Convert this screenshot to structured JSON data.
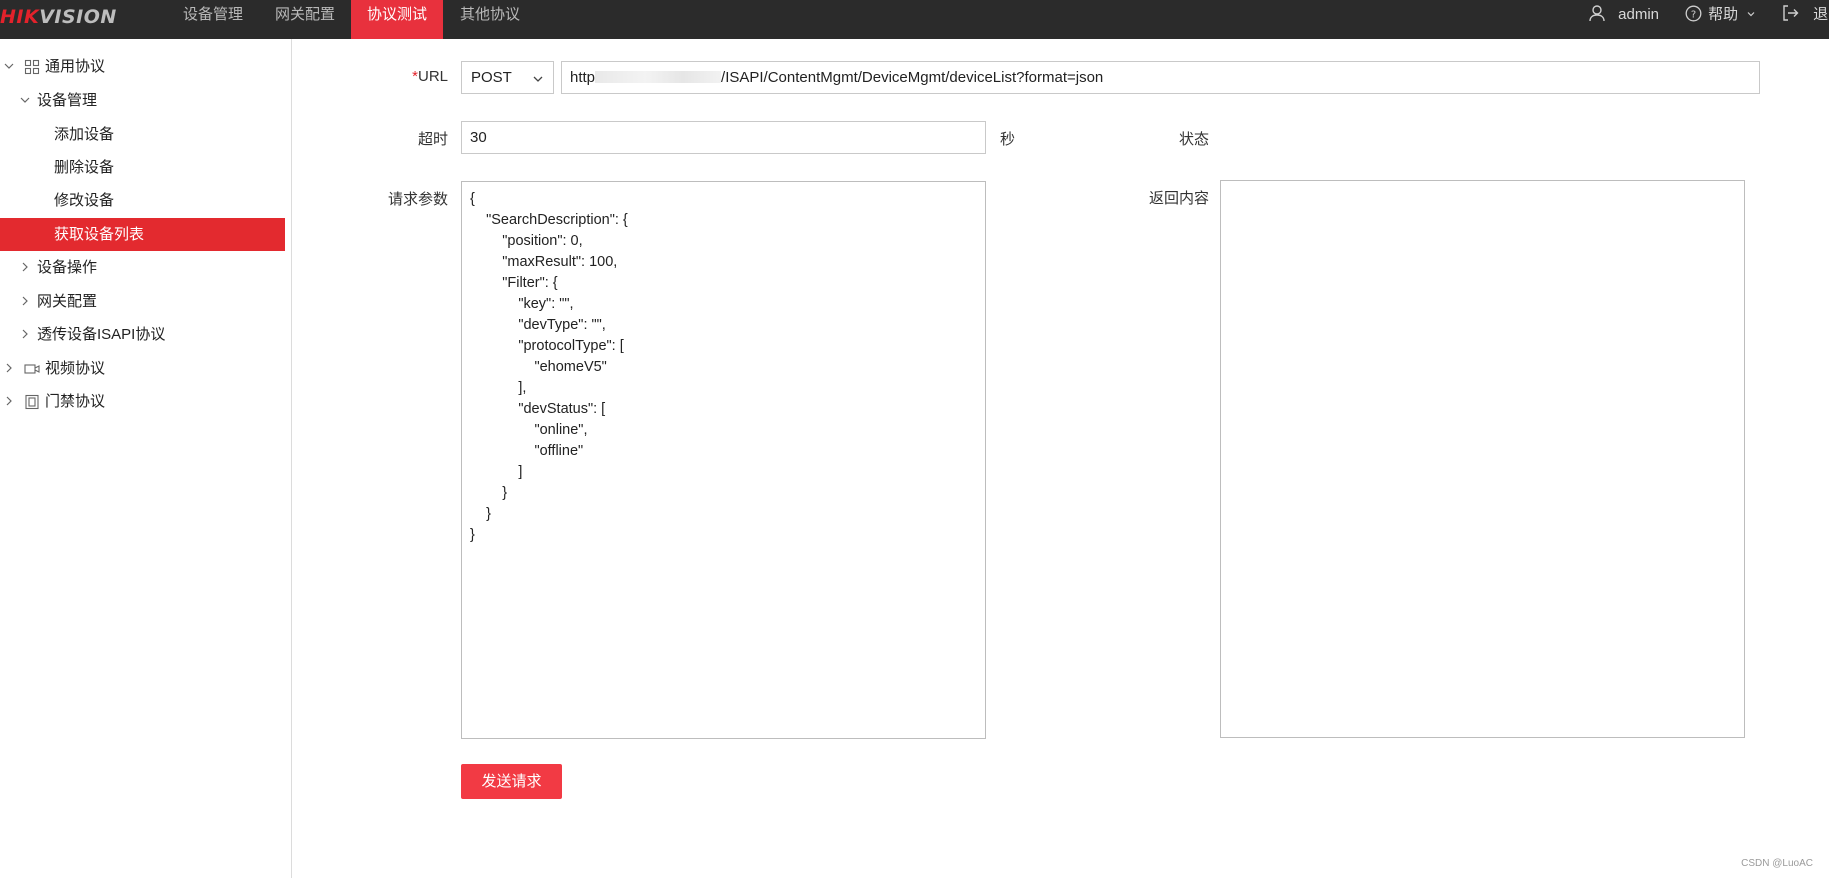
{
  "header": {
    "logo_text_red": "HIK",
    "logo_text_rest": "VISION",
    "tabs": [
      {
        "label": "设备管理"
      },
      {
        "label": "网关配置"
      },
      {
        "label": "协议测试"
      },
      {
        "label": "其他协议"
      }
    ],
    "active_tab": "协议测试",
    "user": "admin",
    "help": "帮助",
    "logout": "退"
  },
  "sidebar": {
    "items": [
      {
        "label": "通用协议",
        "icon": "grid-icon",
        "expanded": true
      },
      {
        "label": "设备管理",
        "expanded": true
      },
      {
        "label": "添加设备"
      },
      {
        "label": "删除设备"
      },
      {
        "label": "修改设备"
      },
      {
        "label": "获取设备列表",
        "selected": true
      },
      {
        "label": "设备操作",
        "expanded": false
      },
      {
        "label": "网关配置",
        "expanded": false
      },
      {
        "label": "透传设备ISAPI协议",
        "expanded": false
      },
      {
        "label": "视频协议",
        "icon": "camera-icon",
        "expanded": false
      },
      {
        "label": "门禁协议",
        "icon": "door-icon",
        "expanded": false
      }
    ]
  },
  "form": {
    "url_required_mark": "*",
    "url_label": "URL",
    "method": "POST",
    "url_prefix": "http",
    "url_value": "/ISAPI/ContentMgmt/DeviceMgmt/deviceList?format=json",
    "timeout_label": "超时",
    "timeout_value": "30",
    "timeout_unit": "秒",
    "status_label": "状态",
    "params_label": "请求参数",
    "response_label": "返回内容",
    "request_body": "{\n    \"SearchDescription\": {\n        \"position\": 0,\n        \"maxResult\": 100,\n        \"Filter\": {\n            \"key\": \"\",\n            \"devType\": \"\",\n            \"protocolType\": [\n                \"ehomeV5\"\n            ],\n            \"devStatus\": [\n                \"online\",\n                \"offline\"\n            ]\n        }\n    }\n}",
    "response_body": "",
    "send_button": "发送请求"
  },
  "watermark": "CSDN @LuoAC",
  "colors": {
    "brand_red": "#e8313d",
    "topbar_bg": "#2b2b2b"
  }
}
